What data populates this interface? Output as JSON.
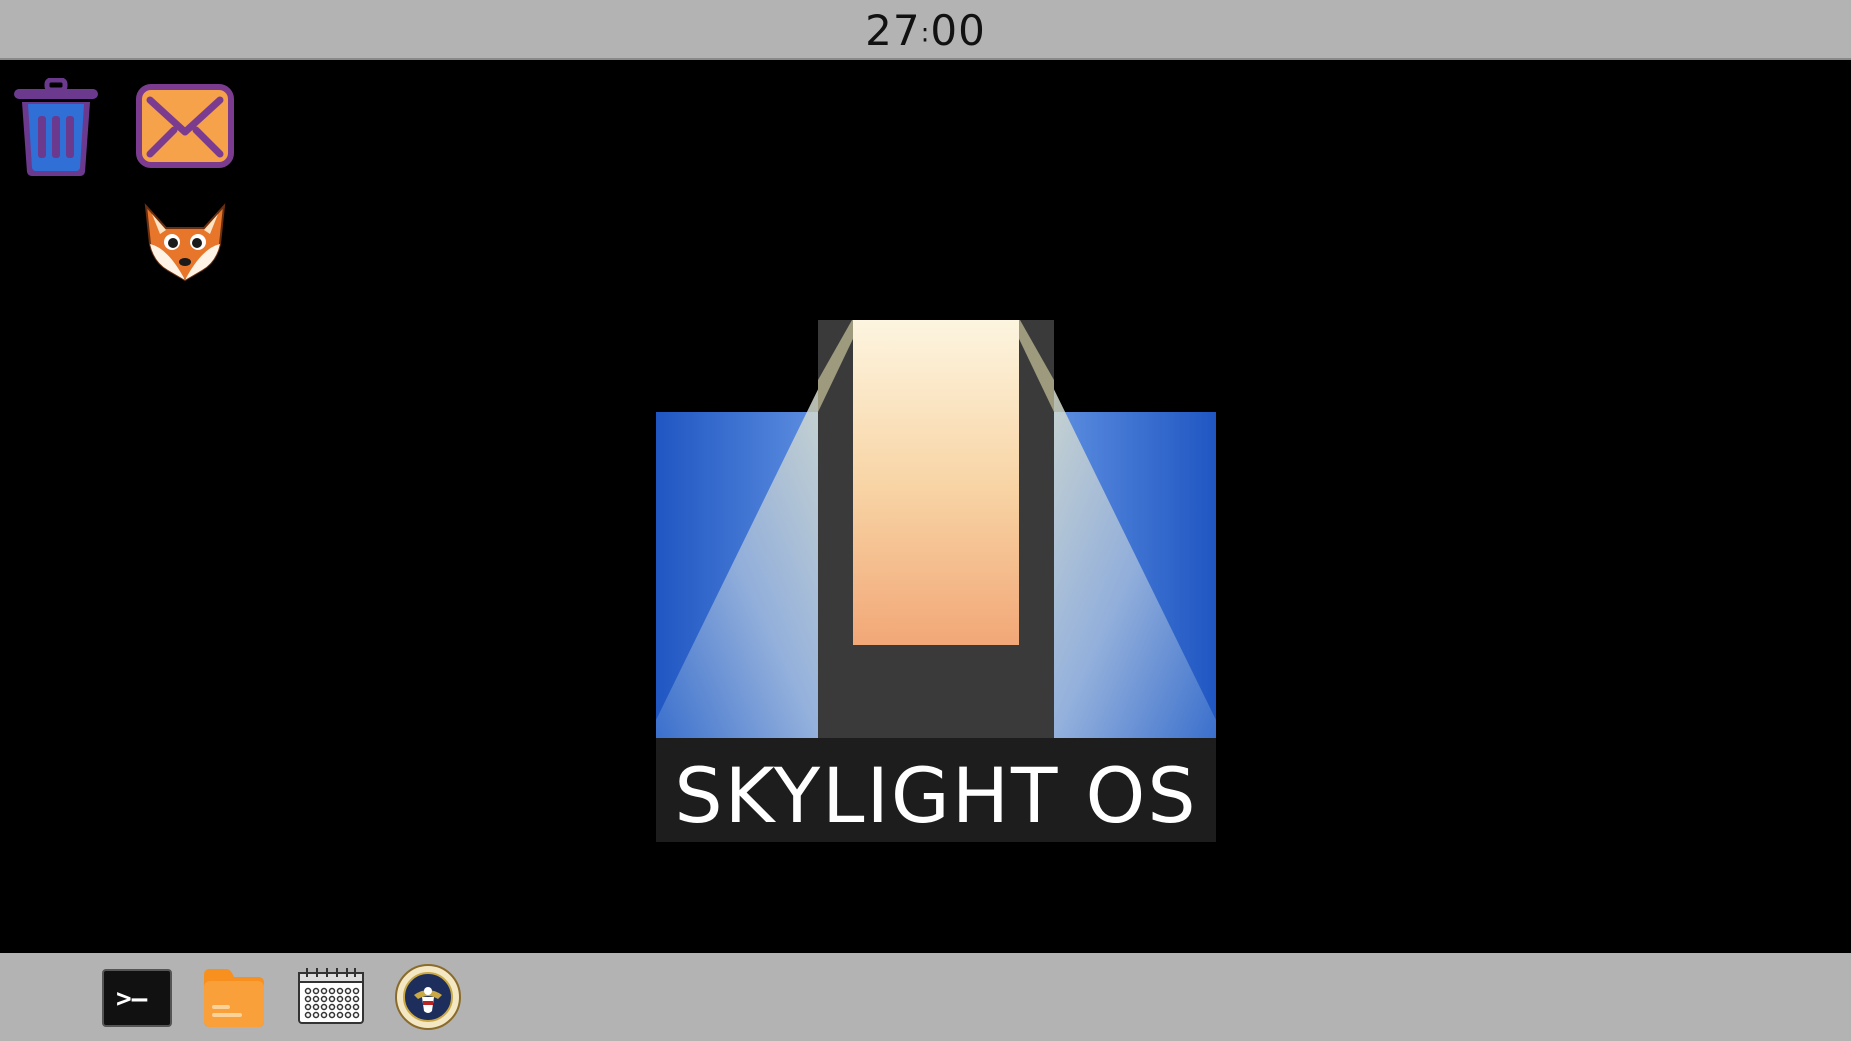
{
  "topbar": {
    "clock_hours": "27",
    "clock_sep": ":",
    "clock_minutes": "00"
  },
  "desktop": {
    "icons": [
      {
        "name": "trash",
        "icon": "trash-icon"
      },
      {
        "name": "mail",
        "icon": "mail-icon"
      },
      {
        "name": "browser",
        "icon": "fox-icon"
      }
    ],
    "logo": {
      "text": "SKYLIGHT OS"
    }
  },
  "taskbar": {
    "items": [
      {
        "name": "terminal",
        "icon": "terminal-icon",
        "glyph": ">–"
      },
      {
        "name": "files",
        "icon": "folder-icon"
      },
      {
        "name": "calendar",
        "icon": "calendar-icon"
      },
      {
        "name": "agency-seal",
        "icon": "seal-icon"
      }
    ]
  },
  "colors": {
    "bar_bg": "#b3b3b3",
    "desktop_bg": "#000000",
    "trash_blue": "#2f6fd6",
    "trash_purple": "#6b3a8e",
    "mail_orange": "#f5a24a",
    "folder_orange": "#f7901e",
    "logo_blue": "#1f56c2",
    "logo_peach": "#f2a777"
  }
}
